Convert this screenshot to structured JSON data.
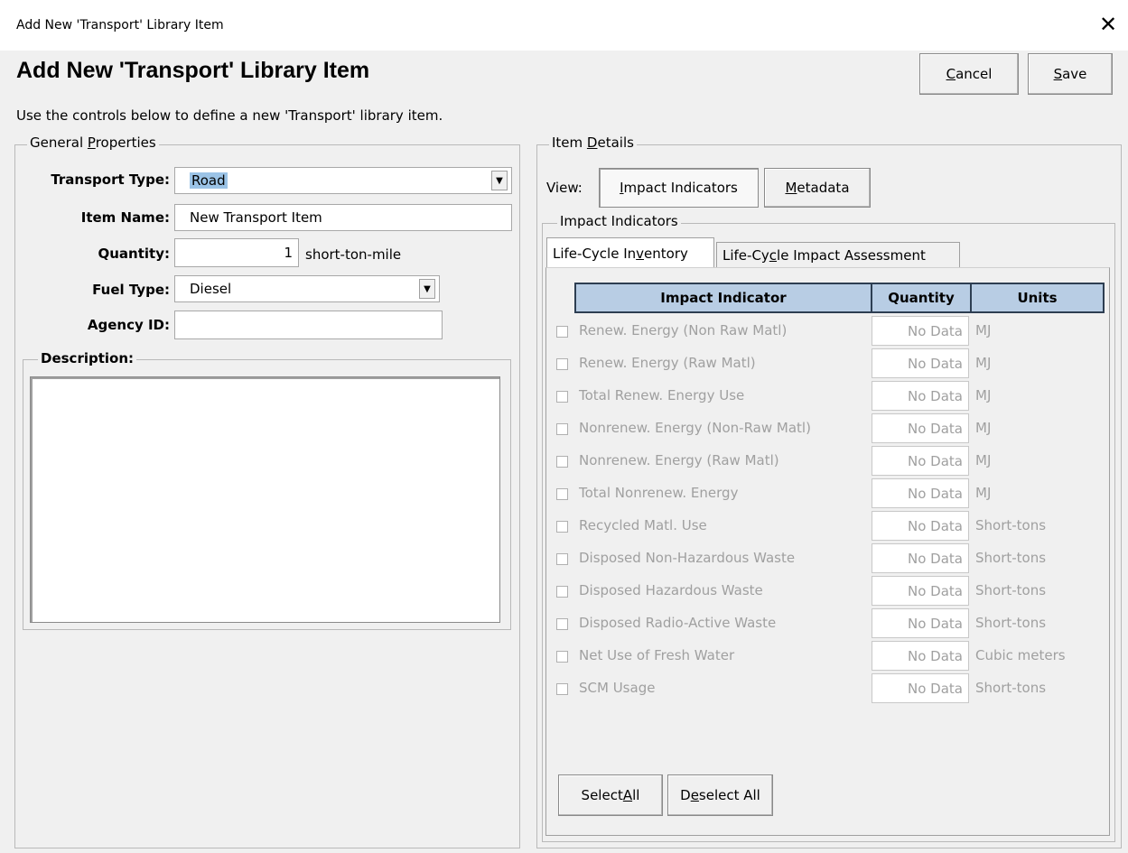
{
  "window": {
    "title": "Add New 'Transport' Library Item",
    "close_glyph": "✕"
  },
  "header": {
    "title": "Add New 'Transport' Library Item",
    "subtitle": "Use the controls below to define a new 'Transport' library item.",
    "cancel_pre": "",
    "cancel_ul": "C",
    "cancel_post": "ancel",
    "save_pre": "",
    "save_ul": "S",
    "save_post": "ave"
  },
  "general": {
    "legend_pre": "General ",
    "legend_ul": "P",
    "legend_post": "roperties",
    "transport_type_label": "Transport Type:",
    "transport_type_value": "Road",
    "item_name_label": "Item Name:",
    "item_name_value": "New Transport Item",
    "quantity_label": "Quantity:",
    "quantity_value": "1",
    "quantity_unit": "short-ton-mile",
    "fuel_type_label": "Fuel Type:",
    "fuel_type_value": "Diesel",
    "agency_id_label": "Agency ID:",
    "agency_id_value": "",
    "description_label": "Description:",
    "description_value": ""
  },
  "details": {
    "legend_pre": "Item ",
    "legend_ul": "D",
    "legend_post": "etails",
    "view_label": "View:",
    "view_impact_pre": "",
    "view_impact_ul": "I",
    "view_impact_post": "mpact Indicators",
    "view_meta_pre": "",
    "view_meta_ul": "M",
    "view_meta_post": "etadata",
    "impact_group_label": "Impact Indicators",
    "tab_lci_pre": "Life-Cycle In",
    "tab_lci_ul": "v",
    "tab_lci_post": "entory",
    "tab_lcia_pre": "Life-Cy",
    "tab_lcia_ul": "c",
    "tab_lcia_post": "le Impact Assessment",
    "columns": {
      "indicator": "Impact Indicator",
      "quantity": "Quantity",
      "units": "Units"
    },
    "rows": [
      {
        "name": "Renew. Energy (Non Raw Matl)",
        "quantity": "No Data",
        "units": "MJ"
      },
      {
        "name": "Renew. Energy (Raw Matl)",
        "quantity": "No Data",
        "units": "MJ"
      },
      {
        "name": "Total Renew. Energy Use",
        "quantity": "No Data",
        "units": "MJ"
      },
      {
        "name": "Nonrenew. Energy (Non-Raw Matl)",
        "quantity": "No Data",
        "units": "MJ"
      },
      {
        "name": "Nonrenew. Energy (Raw Matl)",
        "quantity": "No Data",
        "units": "MJ"
      },
      {
        "name": "Total Nonrenew. Energy",
        "quantity": "No Data",
        "units": "MJ"
      },
      {
        "name": "Recycled Matl. Use",
        "quantity": "No Data",
        "units": "Short-tons"
      },
      {
        "name": "Disposed Non-Hazardous Waste",
        "quantity": "No Data",
        "units": "Short-tons"
      },
      {
        "name": "Disposed Hazardous Waste",
        "quantity": "No Data",
        "units": "Short-tons"
      },
      {
        "name": "Disposed Radio-Active Waste",
        "quantity": "No Data",
        "units": "Short-tons"
      },
      {
        "name": "Net Use of Fresh Water",
        "quantity": "No Data",
        "units": "Cubic meters"
      },
      {
        "name": "SCM Usage",
        "quantity": "No Data",
        "units": "Short-tons"
      }
    ],
    "select_all_pre": "Select ",
    "select_all_ul": "A",
    "select_all_post": "ll",
    "deselect_all_pre": "D",
    "deselect_all_ul": "e",
    "deselect_all_post": "select All"
  },
  "icons": {
    "close": "close-icon",
    "dropdown": "chevron-down-icon"
  }
}
